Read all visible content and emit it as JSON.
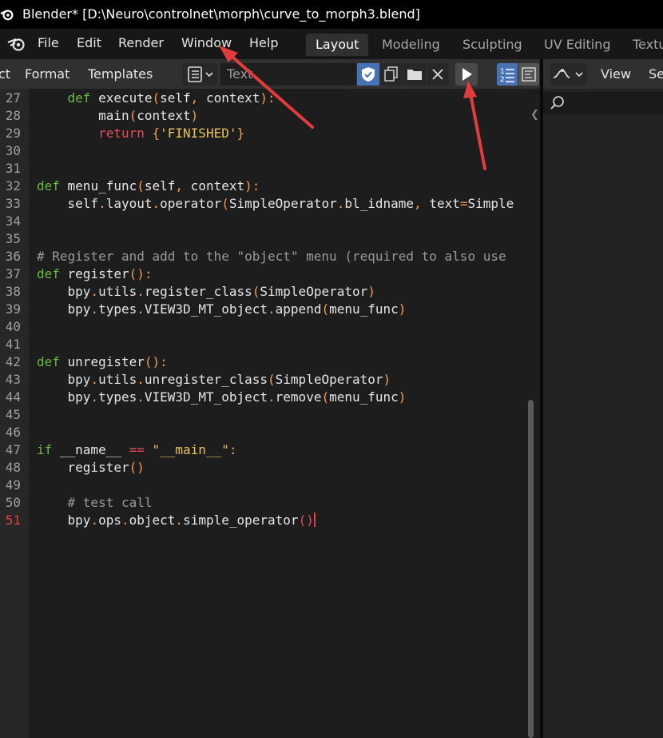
{
  "window": {
    "title": "Blender* [D:\\Neuro\\controlnet\\morph\\curve_to_morph3.blend]"
  },
  "menubar": {
    "items": [
      "File",
      "Edit",
      "Render",
      "Window",
      "Help"
    ]
  },
  "workspaces": {
    "tabs": [
      "Layout",
      "Modeling",
      "Sculpting",
      "UV Editing",
      "Textu"
    ],
    "active": "Layout"
  },
  "editor_header": {
    "menus": [
      "ct",
      "Format",
      "Templates"
    ],
    "text_name": "Text",
    "editor_icon": "text-editor-icon",
    "buttons": [
      "fake-user-shield-icon",
      "new-text-icon",
      "open-folder-icon",
      "close-icon",
      "run-script-play-icon",
      "line-numbers-icon",
      "word-wrap-icon"
    ]
  },
  "right_panel": {
    "menus": [
      "View",
      "Se"
    ],
    "editor_icon": "graph-editor-icon",
    "search_icon": "search-icon"
  },
  "code": {
    "current_line": "51",
    "line_numbers": [
      "27",
      "28",
      "29",
      "30",
      "31",
      "32",
      "33",
      "34",
      "35",
      "36",
      "37",
      "38",
      "39",
      "40",
      "41",
      "42",
      "43",
      "44",
      "45",
      "46",
      "47",
      "48",
      "49",
      "50",
      "51"
    ],
    "lines": [
      "    def execute(self, context):",
      "        main(context)",
      "        return {'FINISHED'}",
      "",
      "",
      "def menu_func(self, context):",
      "    self.layout.operator(SimpleOperator.bl_idname, text=Simple",
      "",
      "",
      "# Register and add to the \"object\" menu (required to also use",
      "def register():",
      "    bpy.utils.register_class(SimpleOperator)",
      "    bpy.types.VIEW3D_MT_object.append(menu_func)",
      "",
      "",
      "def unregister():",
      "    bpy.utils.unregister_class(SimpleOperator)",
      "    bpy.types.VIEW3D_MT_object.remove(menu_func)",
      "",
      "",
      "if __name__ == \"__main__\":",
      "    register()",
      "",
      "    # test call",
      "    bpy.ops.object.simple_operator()"
    ]
  },
  "colors": {
    "keyword": "#6cb948",
    "special": "#e74c5c",
    "string": "#e6c35b",
    "punct": "#f09a55",
    "comment": "#9a9a9a",
    "arrow": "#e03c3c"
  }
}
